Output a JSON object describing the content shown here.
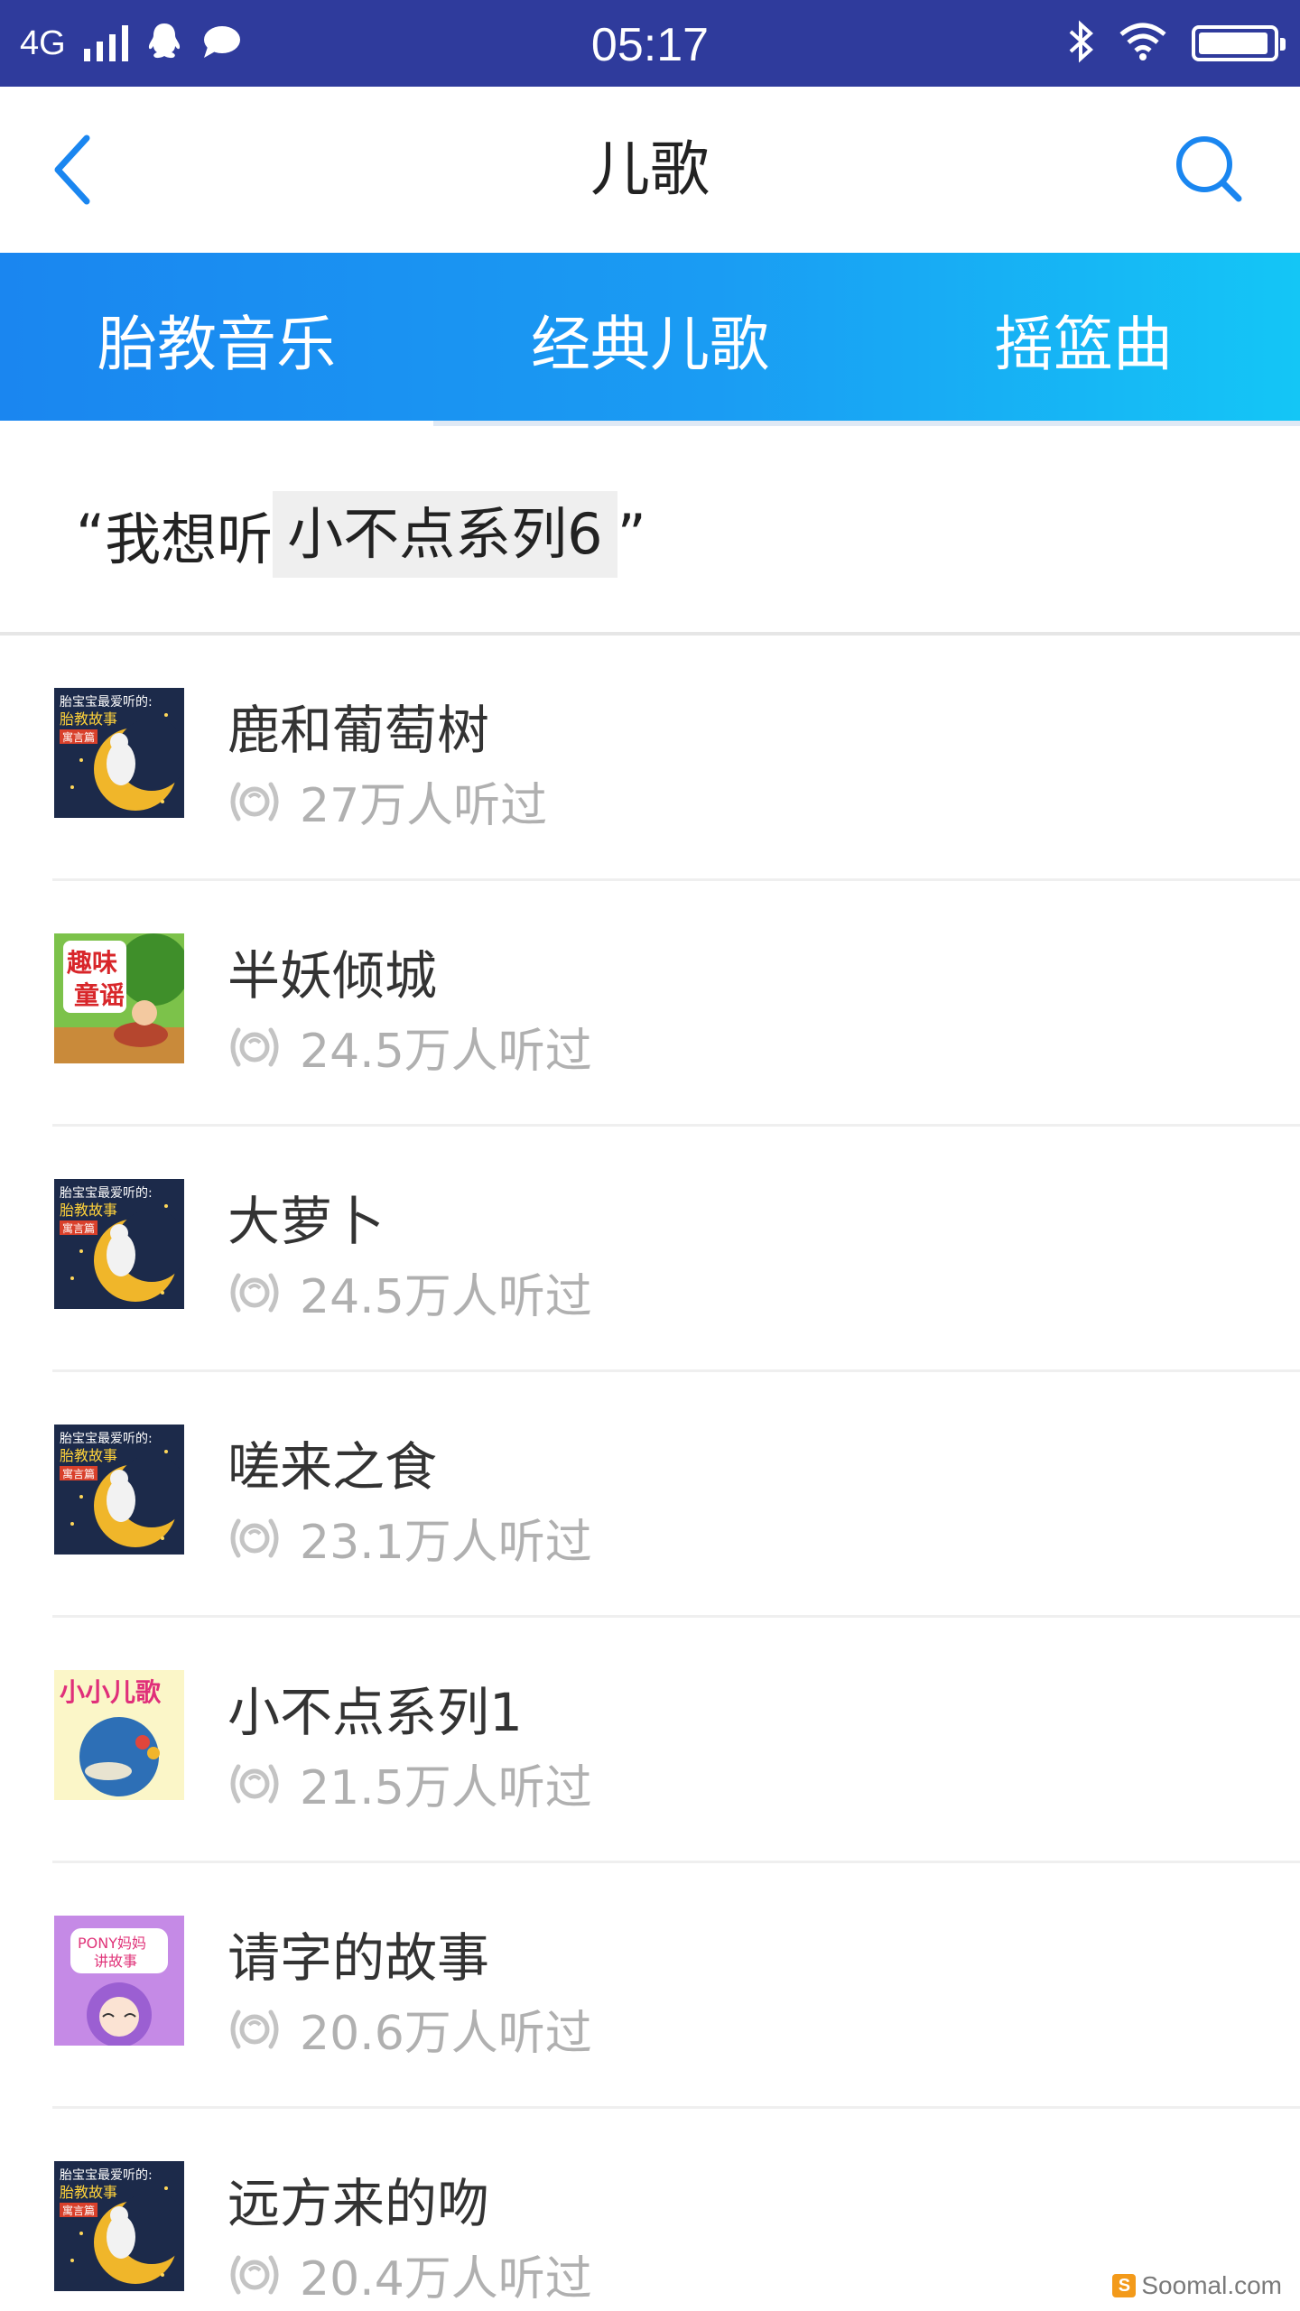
{
  "status_bar": {
    "network": "4G",
    "time": "05:17",
    "battery_level": 0.95
  },
  "header": {
    "title": "儿歌"
  },
  "tabs": [
    {
      "label": "胎教音乐",
      "active": true
    },
    {
      "label": "经典儿歌",
      "active": false
    },
    {
      "label": "摇篮曲",
      "active": false
    }
  ],
  "voice_hint": {
    "open_quote": "“",
    "prefix": "我想听",
    "highlight": "小不点系列6",
    "close_quote": "”"
  },
  "songs": [
    {
      "title": "鹿和葡萄树",
      "plays": "27万人听过",
      "cover": "moon-storybook"
    },
    {
      "title": "半妖倾城",
      "plays": "24.5万人听过",
      "cover": "fun-rhymes"
    },
    {
      "title": "大萝卜",
      "plays": "24.5万人听过",
      "cover": "moon-storybook"
    },
    {
      "title": "嗟来之食",
      "plays": "23.1万人听过",
      "cover": "moon-storybook"
    },
    {
      "title": "小不点系列1",
      "plays": "21.5万人听过",
      "cover": "little-songs"
    },
    {
      "title": "请字的故事",
      "plays": "20.6万人听过",
      "cover": "pony-stories"
    },
    {
      "title": "远方来的吻",
      "plays": "20.4万人听过",
      "cover": "moon-storybook"
    }
  ],
  "covers": {
    "moon-storybook": {
      "line1": "胎宝宝最爱听的:",
      "line2": "胎教故事",
      "tag": "寓言篇"
    },
    "fun-rhymes": {
      "line1": "趣味",
      "line2": "童谣"
    },
    "little-songs": {
      "line1": "小小儿歌"
    },
    "pony-stories": {
      "line1": "PONY妈妈",
      "line2": "讲故事"
    }
  },
  "watermark": "Soomal.com",
  "colors": {
    "status_bar": "#2f3b9c",
    "accent": "#1a86f0",
    "tab_gradient_end": "#14c6f6",
    "meta_text": "#b0b0b0"
  }
}
